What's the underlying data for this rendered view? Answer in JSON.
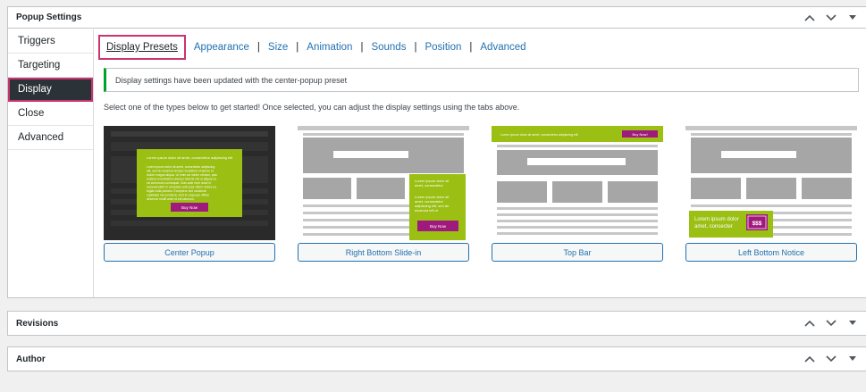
{
  "boxes": {
    "popup_settings": {
      "title": "Popup Settings"
    },
    "revisions": {
      "title": "Revisions"
    },
    "author": {
      "title": "Author"
    }
  },
  "sidebar": {
    "items": [
      {
        "label": "Triggers"
      },
      {
        "label": "Targeting"
      },
      {
        "label": "Display",
        "active": true
      },
      {
        "label": "Close"
      },
      {
        "label": "Advanced"
      }
    ]
  },
  "tabs": [
    {
      "label": "Display Presets",
      "active": true
    },
    {
      "label": "Appearance"
    },
    {
      "label": "Size"
    },
    {
      "label": "Animation"
    },
    {
      "label": "Sounds"
    },
    {
      "label": "Position"
    },
    {
      "label": "Advanced"
    }
  ],
  "tab_separator": "|",
  "notice": {
    "text": "Display settings have been updated with the center-popup preset"
  },
  "intro": "Select one of the types below to get started! Once selected, you can adjust the display settings using the tabs above.",
  "presets": [
    {
      "label": "Center Popup",
      "popup_text": [
        "Lorem ipsum dolor sit amet, consectetur adipiscing elit",
        "Lorem ipsum dolor sit amet, consectetur adipiscing",
        "elit, sed do eiusmod tempor incididunt ut labore et",
        "dolore magna aliqua. Ut enim ad minim veniam, quis",
        "nostrud exercitation ullamco laboris nisi ut aliquip ex",
        "ea commodo consequat. Duis aute irure dolor in",
        "reprehenderit in voluptate velit esse cillum dolore eu",
        "fugiat nulla pariatur. Excepteur sint occaecat",
        "cupidatat non proident, sunt in culpa qui officia",
        "deserunt mollit anim id est laborum."
      ],
      "cta": "Buy Now"
    },
    {
      "label": "Right Bottom Slide-in",
      "popup_text": [
        "Lorem ipsum dolor sit",
        "amet, consectetur",
        "Lorem ipsum dolor sit",
        "amet, consectetur",
        "adipiscing elit, sed do",
        "eiusmod tell ut"
      ],
      "cta": "Buy Now"
    },
    {
      "label": "Top Bar",
      "popup_text": [
        "Lorem ipsum dolor sit amet, consectetur adipiscing elit"
      ],
      "cta": "Buy Now!"
    },
    {
      "label": "Left Bottom Notice",
      "popup_text": [
        "Lorem ipsum dolor",
        "amet, consecter"
      ],
      "cta": "$$$"
    }
  ],
  "colors": {
    "accent_green": "#9bbf12",
    "cta_magenta": "#a01a7d",
    "highlight_pink": "#c9356e",
    "link_blue": "#2271b1",
    "dark_sidebar": "#2c3338",
    "notice_green": "#00a32a"
  },
  "icons": [
    "chevron-up-icon",
    "chevron-down-icon",
    "caret-down-icon"
  ]
}
